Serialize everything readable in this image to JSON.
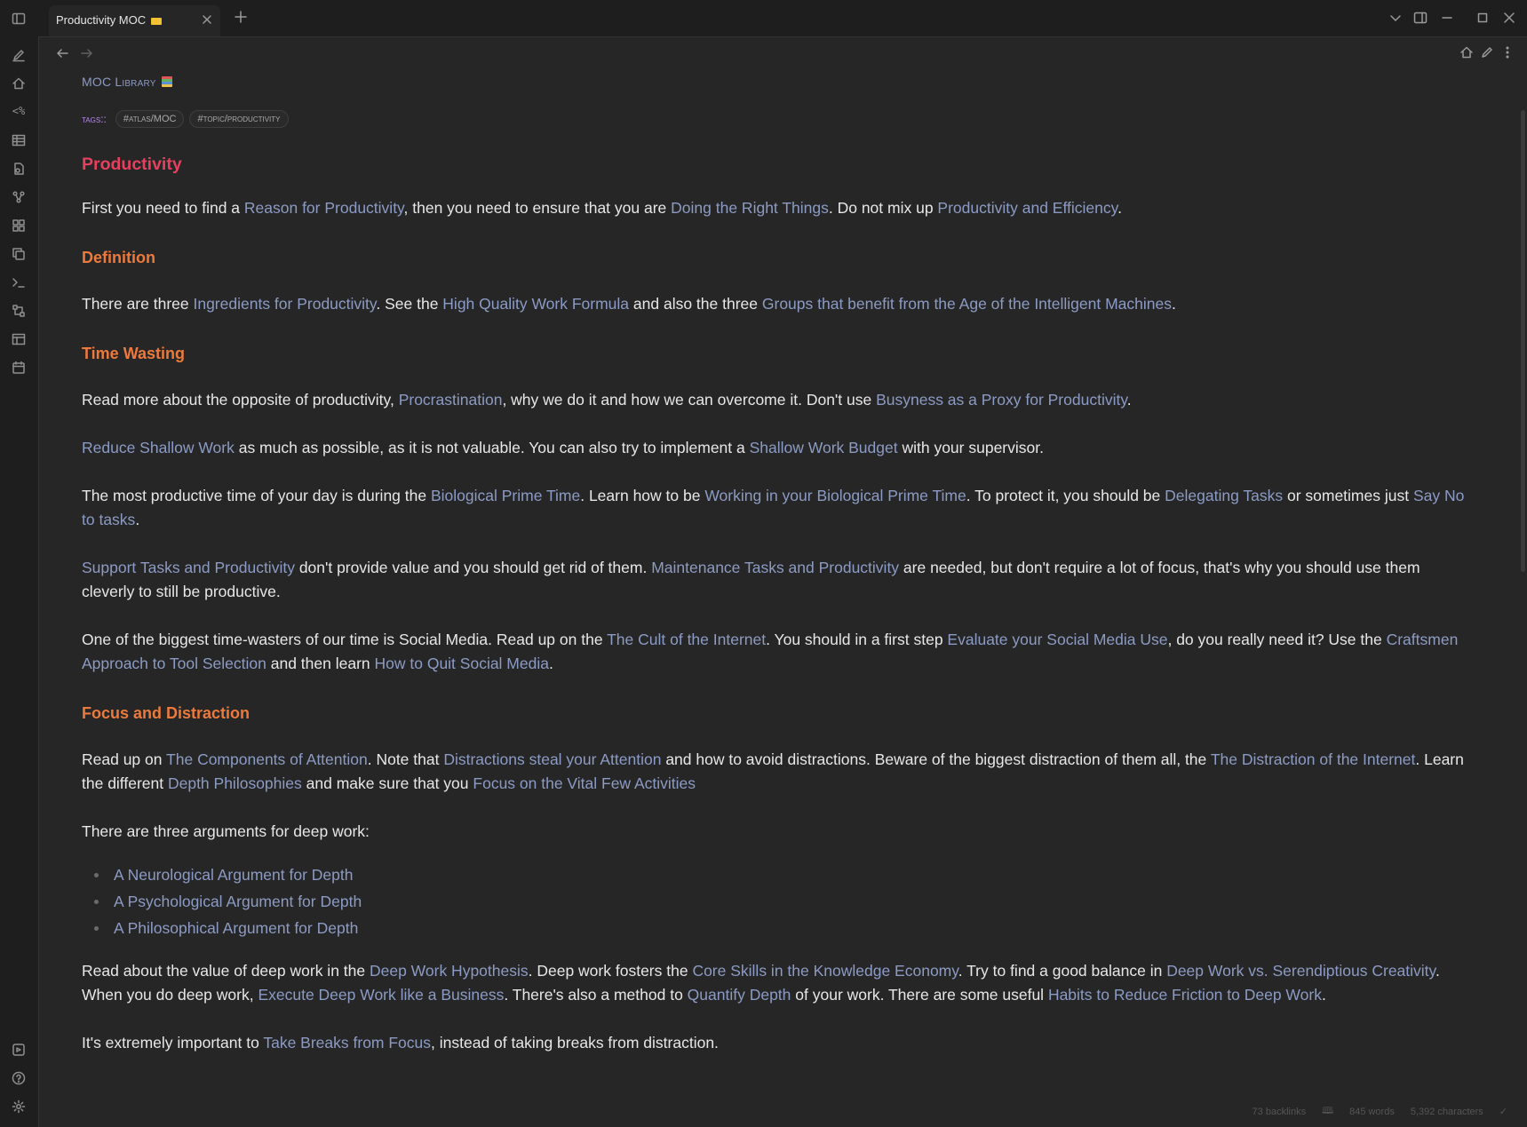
{
  "app": {
    "tab_title": "Productivity MOC",
    "new_tab": "+"
  },
  "ribbon": {
    "icons": [
      "quick-switcher-icon",
      "home-icon",
      "templater-icon",
      "table-icon",
      "file-recovery-icon",
      "graph-icon",
      "plugins-grid-icon",
      "copy-icon",
      "terminal-icon",
      "workspaces-icon",
      "canvas-icon",
      "calendar-icon",
      "vault-icon",
      "help-icon",
      "settings-icon"
    ],
    "templater_glyph": "<%"
  },
  "note": {
    "breadcrumb": "MOC Library",
    "tags_label": "tags::",
    "tags": [
      "#atlas/MOC",
      "#topic/productivity"
    ],
    "title": "Productivity",
    "intro": {
      "t1": "First you need to find a ",
      "l1": "Reason for Productivity",
      "t2": ", then you need to ensure that you are ",
      "l2": "Doing the Right Things",
      "t3": ". Do not mix up ",
      "l3": "Productivity and Efficiency",
      "t4": "."
    },
    "definition": {
      "heading": "Definition",
      "t1": "There are three ",
      "l1": "Ingredients for Productivity",
      "t2": ". See the ",
      "l2": "High Quality Work Formula",
      "t3": " and also the three ",
      "l3": "Groups that benefit from the Age of the Intelligent Machines",
      "t4": "."
    },
    "time_wasting": {
      "heading": "Time Wasting",
      "p1": {
        "t1": "Read more about the opposite of productivity, ",
        "l1": "Procrastination",
        "t2": ", why we do it and how we can overcome it. Don't use ",
        "l2": "Busyness as a Proxy for Productivity",
        "t3": "."
      },
      "p2": {
        "l1": "Reduce Shallow Work",
        "t1": " as much as possible, as it is not valuable. You can also try to implement a ",
        "l2": "Shallow Work Budget",
        "t2": " with your supervisor."
      },
      "p3": {
        "t1": "The most productive time of your day is during the ",
        "l1": "Biological Prime Time",
        "t2": ". Learn how to be ",
        "l2": "Working in your Biological Prime Time",
        "t3": ". To protect it, you should be ",
        "l3": "Delegating Tasks",
        "t4": " or sometimes just ",
        "l4": "Say No to tasks",
        "t5": "."
      },
      "p4": {
        "l1": "Support Tasks and Productivity",
        "t1": " don't provide value and you should get rid of them. ",
        "l2": "Maintenance Tasks and Productivity",
        "t2": " are needed, but don't require a lot of focus, that's why you should use them cleverly to still be productive."
      },
      "p5": {
        "t1": "One of the biggest time-wasters of our time is Social Media. Read up on the ",
        "l1": "The Cult of the Internet",
        "t2": ". You should in a first step ",
        "l2": "Evaluate your Social Media Use",
        "t3": ", do you really need it? Use the ",
        "l3": "Craftsmen Approach to Tool Selection",
        "t4": " and then learn ",
        "l4": "How to Quit Social Media",
        "t5": "."
      }
    },
    "focus": {
      "heading": "Focus and Distraction",
      "p1": {
        "t1": "Read up on ",
        "l1": "The Components of Attention",
        "t2": ". Note that ",
        "l2": "Distractions steal your Attention",
        "t3": " and how to avoid distractions. Beware of the biggest distraction of them all, the ",
        "l3": "The Distraction of the Internet",
        "t4": ". Learn the different ",
        "l4": "Depth Philosophies",
        "t5": " and make sure that you ",
        "l5": "Focus on the Vital Few Activities"
      },
      "p2": "There are three arguments for deep work:",
      "arguments": [
        "A Neurological Argument for Depth",
        "A Psychological Argument for Depth",
        "A Philosophical Argument for Depth"
      ],
      "p3": {
        "t1": "Read about the value of deep work in the ",
        "l1": "Deep Work Hypothesis",
        "t2": ". Deep work fosters the ",
        "l2": "Core Skills in the Knowledge Economy",
        "t3": ". Try to find a good balance in ",
        "l3": "Deep Work vs. Serendiptious Creativity",
        "t4": ". When you do deep work, ",
        "l4": "Execute Deep Work like a Business",
        "t5": ". There's also a method to ",
        "l5": "Quantify Depth",
        "t6": " of your work. There are some useful ",
        "l6": "Habits to Reduce Friction to Deep Work",
        "t7": "."
      },
      "p4": {
        "t1": "It's extremely important to ",
        "l1": "Take Breaks from Focus",
        "t2": ", instead of taking breaks from distraction."
      }
    }
  },
  "status": {
    "backlinks": "73 backlinks",
    "words": "845 words",
    "characters": "5,392 characters"
  }
}
